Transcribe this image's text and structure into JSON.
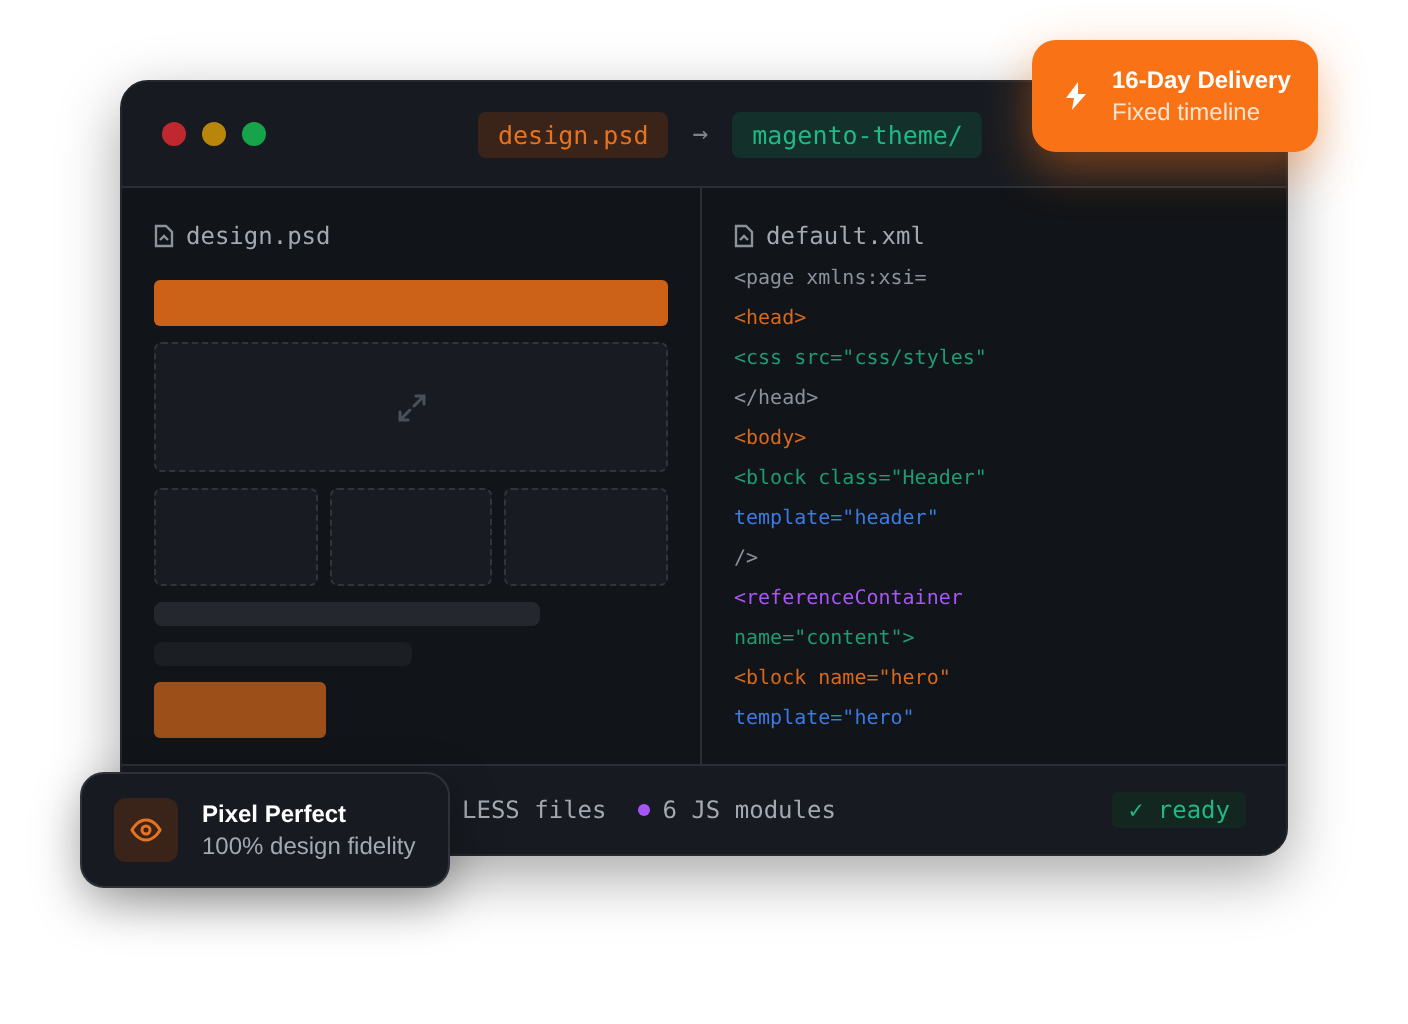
{
  "window": {
    "traffic_lights": [
      {
        "color": "#c0282f"
      },
      {
        "color": "#b8860b"
      },
      {
        "color": "#16a34a"
      }
    ],
    "source": "design.psd",
    "arrow": "→",
    "target": "magento-theme/"
  },
  "design_pane": {
    "file": "design.psd"
  },
  "code_pane": {
    "file": "default.xml",
    "lines": [
      {
        "text": "<page xmlns:xsi=",
        "color": "#8b929c"
      },
      {
        "text": "<head>",
        "color": "#d9691a"
      },
      {
        "text": "<css src=\"css/styles\"",
        "color": "#1c9c70"
      },
      {
        "text": "</head>",
        "color": "#8b929c"
      },
      {
        "text": "<body>",
        "color": "#d9691a"
      },
      {
        "text": "<block class=\"Header\"",
        "color": "#1c9c70"
      },
      {
        "text": "template=\"header\"",
        "color": "#3a7be0"
      },
      {
        "text": "/>",
        "color": "#8b929c"
      },
      {
        "text": "<referenceContainer",
        "color": "#a855f7"
      },
      {
        "text": "name=\"content\">",
        "color": "#1c9c70"
      },
      {
        "text": "<block name=\"hero\"",
        "color": "#d9691a"
      },
      {
        "text": "template=\"hero\"",
        "color": "#3a7be0"
      }
    ]
  },
  "footer": {
    "items": [
      {
        "text": "LESS files"
      },
      {
        "text": "6 JS modules",
        "color": "#a855f7"
      }
    ],
    "status": "✓ ready"
  },
  "badges": [
    {
      "kind": "delivery",
      "title": "16-Day Delivery",
      "subtitle": "Fixed timeline"
    },
    {
      "kind": "quality",
      "title": "Pixel Perfect",
      "subtitle": "100% design fidelity"
    }
  ]
}
